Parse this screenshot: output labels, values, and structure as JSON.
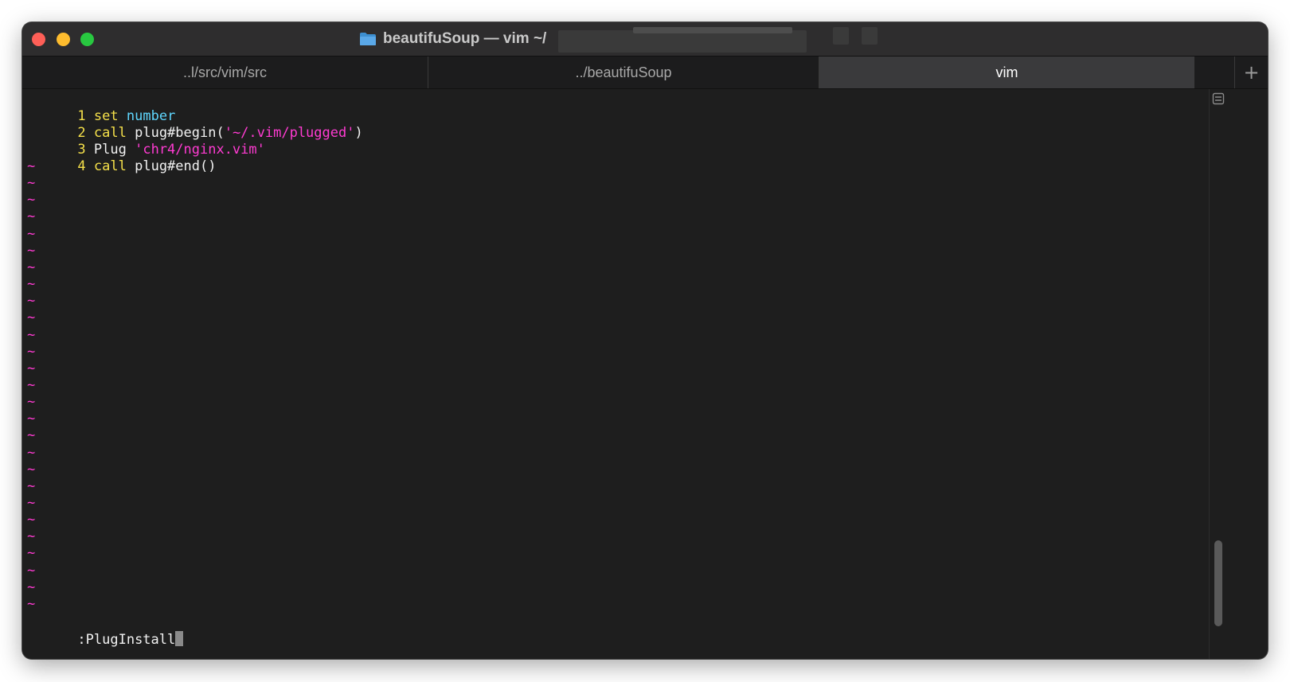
{
  "window": {
    "title": "beautifuSoup — vim ~/",
    "traffic_lights": {
      "close_color": "#fe5f57",
      "minimize_color": "#febc2e",
      "maximize_color": "#28c840"
    }
  },
  "tabs": [
    {
      "label": "..l/src/vim/src",
      "active": false
    },
    {
      "label": "../beautifuSoup",
      "active": false
    },
    {
      "label": "vim",
      "active": true
    }
  ],
  "new_tab_label": "+",
  "editor": {
    "lines": [
      {
        "number": "1",
        "parts": [
          {
            "text": "set",
            "role": "keyword"
          },
          {
            "text": " ",
            "role": "plain"
          },
          {
            "text": "number",
            "role": "option"
          }
        ]
      },
      {
        "number": "2",
        "parts": [
          {
            "text": "call",
            "role": "keyword"
          },
          {
            "text": " plug#begin(",
            "role": "plain"
          },
          {
            "text": "'~/.vim/plugged'",
            "role": "string"
          },
          {
            "text": ")",
            "role": "plain"
          }
        ]
      },
      {
        "number": "3",
        "parts": [
          {
            "text": "Plug ",
            "role": "plain"
          },
          {
            "text": "'chr4/nginx.vim'",
            "role": "string"
          }
        ]
      },
      {
        "number": "4",
        "parts": [
          {
            "text": "call",
            "role": "keyword"
          },
          {
            "text": " plug#end()",
            "role": "plain"
          }
        ]
      }
    ],
    "empty_line_marker": "~",
    "empty_line_count": 27,
    "command_line": ":PlugInstall"
  },
  "colors": {
    "line_number": "#f5e04a",
    "keyword": "#f5e04a",
    "option": "#5fd7ff",
    "string": "#ff3bd2",
    "plain": "#f2f2f2",
    "tilde": "#ff3bd2",
    "background": "#1e1e1e"
  }
}
